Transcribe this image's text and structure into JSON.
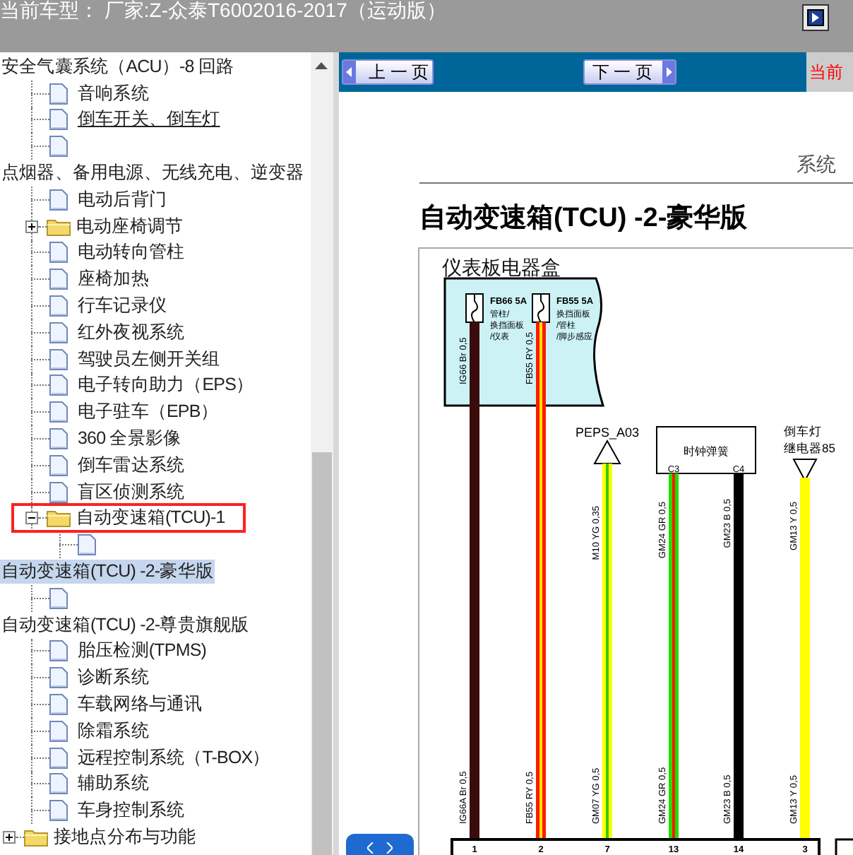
{
  "title_bar": {
    "text": "当前车型： 厂家:Z-众泰T6002016-2017（运动版）"
  },
  "tree": [
    {
      "kind": "group",
      "label": "安全气囊系统（ACU）-8 回路",
      "selected": false,
      "hovered": false,
      "marked": false,
      "children": [
        {
          "kind": "page",
          "label": "音响系统",
          "selected": false,
          "hovered": false,
          "marked": false
        },
        {
          "kind": "page",
          "label": "倒车开关、倒车灯",
          "selected": false,
          "hovered": true,
          "marked": false
        },
        {
          "kind": "page",
          "selected": false,
          "marked": false
        }
      ]
    },
    {
      "kind": "group",
      "label": "点烟器、备用电源、无线充电、逆变器",
      "selected": false,
      "hovered": false,
      "marked": false,
      "children": [
        {
          "kind": "page",
          "label": "电动后背门",
          "selected": false,
          "hovered": false,
          "marked": false
        },
        {
          "kind": "folder",
          "label": "电动座椅调节",
          "expanded": false,
          "selected": false,
          "hovered": false,
          "marked": false
        },
        {
          "kind": "page",
          "label": "电动转向管柱",
          "selected": false,
          "hovered": false,
          "marked": false
        },
        {
          "kind": "page",
          "label": "座椅加热",
          "selected": false,
          "hovered": false,
          "marked": false
        },
        {
          "kind": "page",
          "label": "行车记录仪",
          "selected": false,
          "hovered": false,
          "marked": false
        },
        {
          "kind": "page",
          "label": "红外夜视系统",
          "selected": false,
          "hovered": false,
          "marked": false
        },
        {
          "kind": "page",
          "label": "驾驶员左侧开关组",
          "selected": false,
          "hovered": false,
          "marked": false
        },
        {
          "kind": "page",
          "label": "电子转向助力（EPS）",
          "selected": false,
          "hovered": false,
          "marked": false
        },
        {
          "kind": "page",
          "label": "电子驻车（EPB）",
          "selected": false,
          "hovered": false,
          "marked": false
        },
        {
          "kind": "page",
          "label": "360 全景影像",
          "selected": false,
          "hovered": false,
          "marked": false
        },
        {
          "kind": "page",
          "label": "倒车雷达系统",
          "selected": false,
          "hovered": false,
          "marked": false
        },
        {
          "kind": "page",
          "label": "盲区侦测系统",
          "selected": false,
          "hovered": false,
          "marked": false
        },
        {
          "kind": "folder",
          "label": "自动变速箱(TCU)-1",
          "expanded": true,
          "selected": false,
          "hovered": false,
          "marked": true,
          "children": [
            {
              "kind": "page",
              "selected": false,
              "marked": false
            }
          ]
        }
      ]
    },
    {
      "kind": "group",
      "label": "自动变速箱(TCU) -2-豪华版",
      "selected": true,
      "hovered": false,
      "marked": false,
      "children": [
        {
          "kind": "page",
          "selected": false,
          "marked": false
        }
      ]
    },
    {
      "kind": "group",
      "label": "自动变速箱(TCU) -2-尊贵旗舰版",
      "selected": false,
      "hovered": false,
      "marked": false,
      "children": [
        {
          "kind": "page",
          "label": "胎压检测(TPMS)",
          "selected": false,
          "hovered": false,
          "marked": false
        },
        {
          "kind": "page",
          "label": "诊断系统",
          "selected": false,
          "hovered": false,
          "marked": false
        },
        {
          "kind": "page",
          "label": "车载网络与通讯",
          "selected": false,
          "hovered": false,
          "marked": false
        },
        {
          "kind": "page",
          "label": "除霜系统",
          "selected": false,
          "hovered": false,
          "marked": false
        },
        {
          "kind": "page",
          "label": "远程控制系统（T-BOX）",
          "selected": false,
          "hovered": false,
          "marked": false
        },
        {
          "kind": "page",
          "label": "辅助系统",
          "selected": false,
          "hovered": false,
          "marked": false
        },
        {
          "kind": "page",
          "label": "车身控制系统",
          "selected": false,
          "hovered": false,
          "marked": false
        }
      ]
    },
    {
      "kind": "folder",
      "label": "接地点分布与功能",
      "expanded": false,
      "selected": false,
      "hovered": false,
      "marked": false
    }
  ],
  "nav": {
    "prev": "上 一 页",
    "next": "下 一 页",
    "notice": "当前"
  },
  "document": {
    "header": "系统",
    "title": "自动变速箱(TCU) -2-豪华版",
    "diagram": {
      "box_label": "仪表板电器盒",
      "fuses": [
        {
          "label": "FB66 5A",
          "notes": [
            "管柱/",
            "换挡面板",
            "/仪表"
          ]
        },
        {
          "label": "FB55 5A",
          "notes": [
            "换挡面板",
            "/管柱",
            "/脚步感应"
          ]
        }
      ],
      "sources": [
        {
          "kind": "terminal",
          "lines": [
            "PEPS_A03"
          ]
        },
        {
          "kind": "component",
          "lines": [
            "时钟弹簧"
          ],
          "pins": [
            "C3",
            "C4"
          ]
        },
        {
          "kind": "relay",
          "lines": [
            "倒车灯",
            "继电器85"
          ]
        }
      ],
      "wires": [
        {
          "top_label": "IG66 Br 0,5",
          "bottom_label": "IG66A Br 0,5",
          "pin": "1",
          "color": "#3a0c0c"
        },
        {
          "top_label": "FB55 RY 0,5",
          "bottom_label": "FB55 RY 0,5",
          "pin": "2",
          "color": "#ff1a00",
          "stripe": {
            "color": "#ffe600"
          }
        },
        {
          "top_label": "M10 YG 0,35",
          "bottom_label": "GM07 YG 0,5",
          "pin": "7",
          "color": "#ffff00",
          "stripe": {
            "color": "#33cc00"
          }
        },
        {
          "top_label": "GM24 GR 0,5",
          "bottom_label": "GM24 GR 0,5",
          "pin": "13",
          "color": "#22dd00",
          "stripe": {
            "color": "#ff1a00"
          }
        },
        {
          "top_label": "GM23 B 0,5",
          "bottom_label": "GM23 B 0,5",
          "pin": "14",
          "color": "#000000"
        },
        {
          "top_label": "GM13 Y 0,5",
          "bottom_label": "GM13 Y 0,5",
          "pin": "3",
          "color": "#ffff00"
        }
      ]
    }
  }
}
